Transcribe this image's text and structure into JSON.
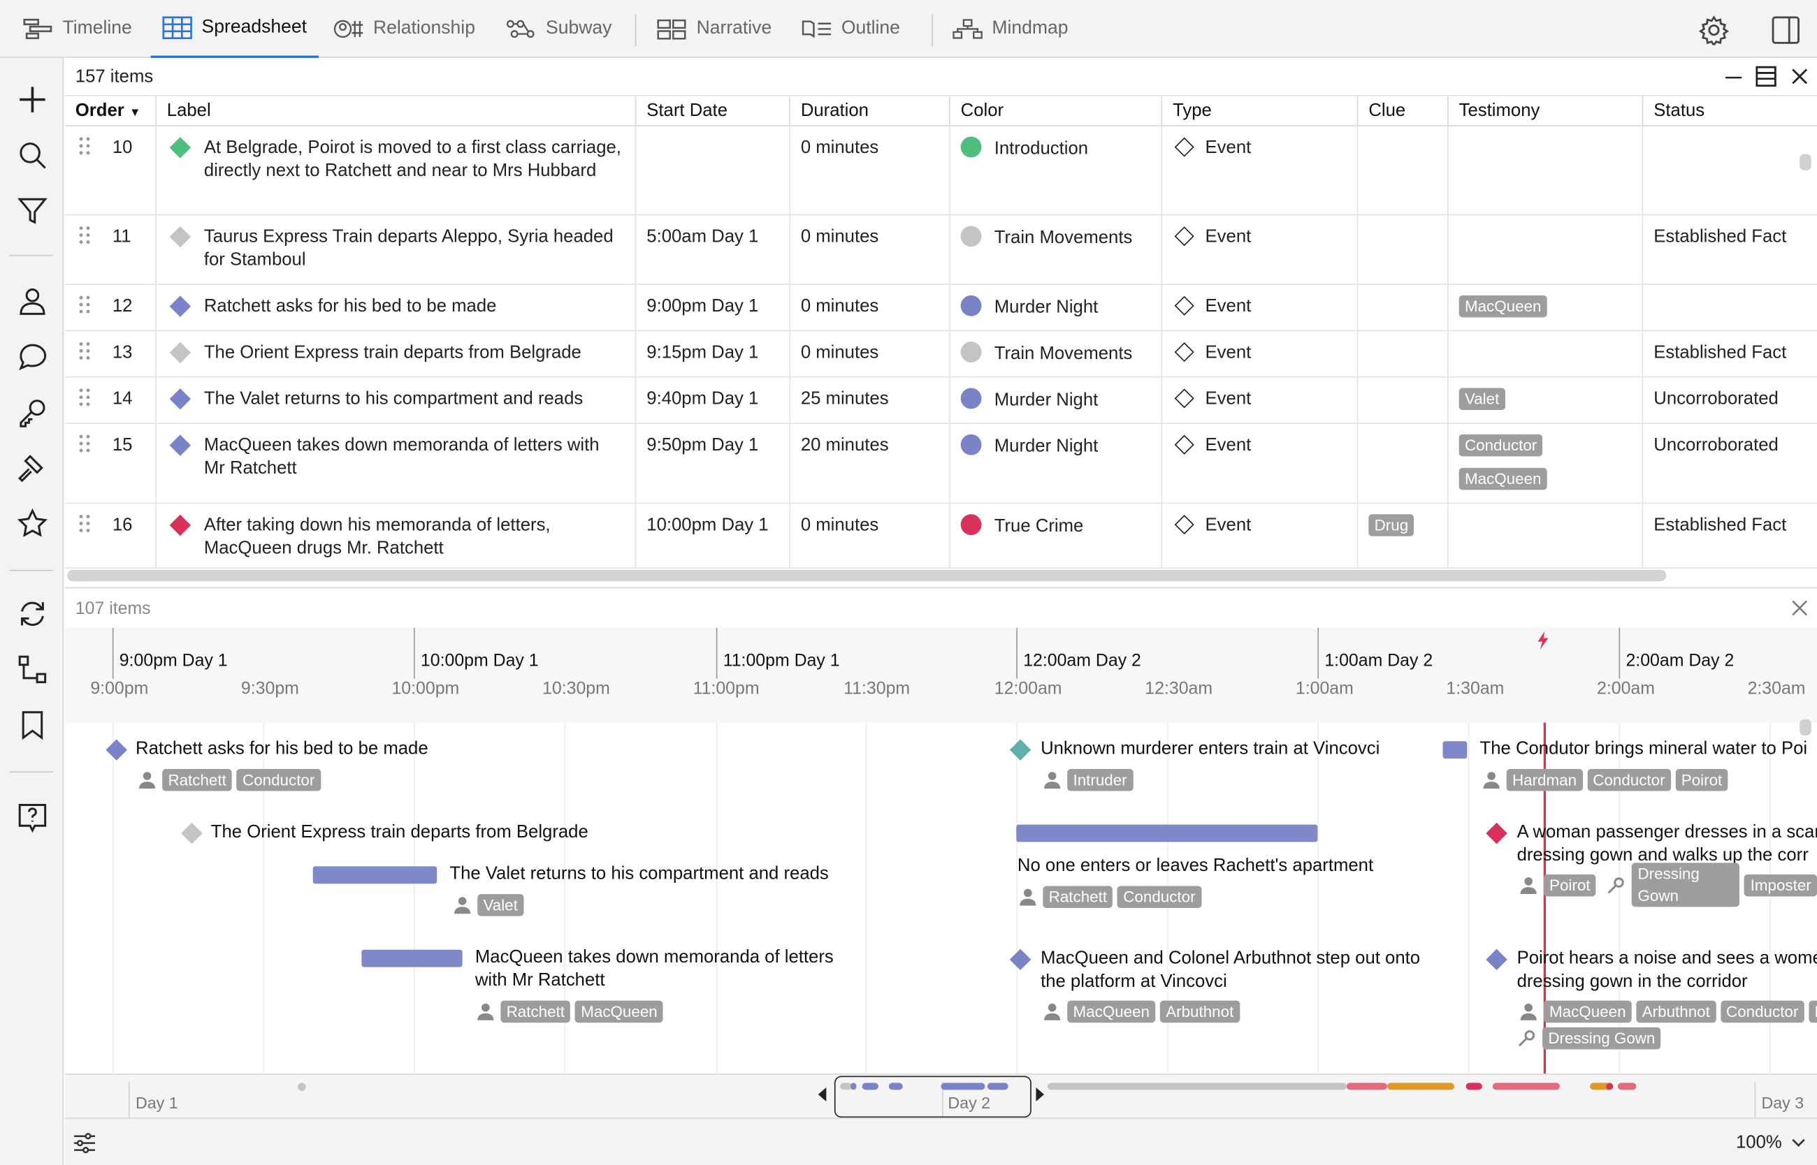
{
  "tabs": [
    {
      "label": "Timeline",
      "icon": "timeline-icon"
    },
    {
      "label": "Spreadsheet",
      "icon": "spreadsheet-icon"
    },
    {
      "label": "Relationship",
      "icon": "relationship-icon"
    },
    {
      "label": "Subway",
      "icon": "subway-icon"
    },
    {
      "label": "Narrative",
      "icon": "narrative-icon"
    },
    {
      "label": "Outline",
      "icon": "outline-icon"
    },
    {
      "label": "Mindmap",
      "icon": "mindmap-icon"
    }
  ],
  "active_tab": "Spreadsheet",
  "grid": {
    "count": "157 items",
    "columns": [
      "Order",
      "Label",
      "Start Date",
      "Duration",
      "Color",
      "Type",
      "Clue",
      "Testimony",
      "Status"
    ],
    "rows": [
      {
        "order": "10",
        "label": "At Belgrade, Poirot is moved to a first class carriage, directly next to Ratchett and near to Mrs Hubbard",
        "start": "",
        "duration": "0 minutes",
        "color": "Introduction",
        "color_hex": "#4fbf80",
        "type": "Event",
        "clue": [],
        "testimony": [],
        "status": ""
      },
      {
        "order": "11",
        "label": "Taurus Express Train departs Aleppo, Syria headed for Stamboul",
        "start": "5:00am Day 1",
        "duration": "0 minutes",
        "color": "Train Movements",
        "color_hex": "#c4c4c4",
        "type": "Event",
        "clue": [],
        "testimony": [],
        "status": "Established Fact"
      },
      {
        "order": "12",
        "label": "Ratchett asks for his bed to be made",
        "start": "9:00pm Day 1",
        "duration": "0 minutes",
        "color": "Murder Night",
        "color_hex": "#7a83c8",
        "type": "Event",
        "clue": [],
        "testimony": [
          "MacQueen"
        ],
        "status": ""
      },
      {
        "order": "13",
        "label": "The Orient Express train departs from Belgrade",
        "start": "9:15pm Day 1",
        "duration": "0 minutes",
        "color": "Train Movements",
        "color_hex": "#c4c4c4",
        "type": "Event",
        "clue": [],
        "testimony": [],
        "status": "Established Fact"
      },
      {
        "order": "14",
        "label": "The Valet returns to his compartment and reads",
        "start": "9:40pm Day 1",
        "duration": "25 minutes",
        "color": "Murder Night",
        "color_hex": "#7a83c8",
        "type": "Event",
        "clue": [],
        "testimony": [
          "Valet"
        ],
        "status": "Uncorroborated"
      },
      {
        "order": "15",
        "label": "MacQueen takes down memoranda of letters with Mr Ratchett",
        "start": "9:50pm Day 1",
        "duration": "20 minutes",
        "color": "Murder Night",
        "color_hex": "#7a83c8",
        "type": "Event",
        "clue": [],
        "testimony": [
          "Conductor",
          "MacQueen"
        ],
        "status": "Uncorroborated"
      },
      {
        "order": "16",
        "label": "After taking down his memoranda of letters, MacQueen drugs Mr. Ratchett",
        "start": "10:00pm Day 1",
        "duration": "0 minutes",
        "color": "True Crime",
        "color_hex": "#d8315b",
        "type": "Event",
        "clue": [
          "Drug"
        ],
        "testimony": [],
        "status": "Established Fact"
      }
    ]
  },
  "timeline": {
    "count": "107 items",
    "major_labels": [
      "9:00pm Day 1",
      "10:00pm Day 1",
      "11:00pm Day 1",
      "12:00am Day 2",
      "1:00am Day 2",
      "2:00am Day 2"
    ],
    "minor_labels": [
      "9:00pm",
      "9:30pm",
      "10:00pm",
      "10:30pm",
      "11:00pm",
      "11:30pm",
      "12:00am",
      "12:30am",
      "1:00am",
      "1:30am",
      "2:00am",
      "2:30am"
    ],
    "events": [
      {
        "label": "Ratchett asks for his bed to be made",
        "tags": [
          "Ratchett",
          "Conductor"
        ]
      },
      {
        "label": "The Orient Express train departs from Belgrade",
        "tags": []
      },
      {
        "label": "The Valet returns to his compartment and reads",
        "tags": [
          "Valet"
        ]
      },
      {
        "label": "MacQueen takes down memoranda of letters with Mr Ratchett",
        "tags": [
          "Ratchett",
          "MacQueen"
        ]
      },
      {
        "label": "Unknown murderer enters train at Vincovci",
        "tags": [
          "Intruder"
        ]
      },
      {
        "label": "No one enters or leaves Rachett's apartment",
        "tags": [
          "Ratchett",
          "Conductor"
        ]
      },
      {
        "label": "MacQueen and Colonel Arbuthnot step out onto the platform at Vincovci",
        "tags": [
          "MacQueen",
          "Arbuthnot"
        ]
      },
      {
        "label": "The Condutor brings mineral water to Poi",
        "tags": [
          "Hardman",
          "Conductor",
          "Poirot"
        ]
      },
      {
        "label": "A woman passenger dresses in a scar dressing gown and walks up the corr",
        "tags": [
          "Poirot"
        ],
        "clues": [
          "Dressing Gown",
          "Imposter"
        ]
      },
      {
        "label": "Poirot hears a noise and sees a wome dressing gown in the corridor",
        "tags": [
          "MacQueen",
          "Arbuthnot",
          "Conductor",
          "P"
        ],
        "clues": [
          "Dressing Gown"
        ]
      }
    ]
  },
  "overview": {
    "day_labels": [
      "Day 1",
      "Day 2",
      "Day 3"
    ]
  },
  "footer": {
    "zoom": "100%"
  },
  "colors": {
    "accent": "#2a73d8",
    "murder_night": "#7a83c8",
    "true_crime": "#d8315b",
    "introduction": "#4fbf80",
    "train_movements": "#c4c4c4",
    "intruder": "#5fb0a8",
    "now_line": "#e0324b"
  }
}
